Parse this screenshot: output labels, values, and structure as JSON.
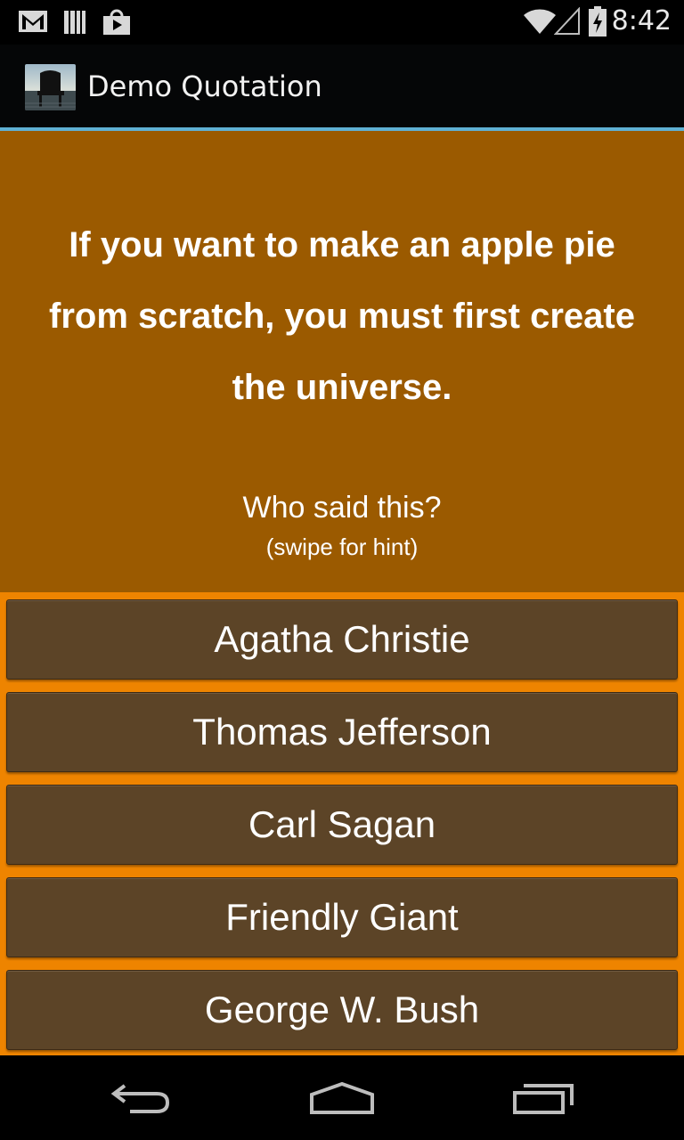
{
  "status_bar": {
    "time": "8:42",
    "icons": [
      "gmail-icon",
      "library-icon",
      "play-store-icon",
      "wifi-icon",
      "signal-icon",
      "battery-charging-icon"
    ]
  },
  "action_bar": {
    "app_icon": "chair-photo-icon",
    "title": "Demo Quotation",
    "accent_color": "#5fb0d4"
  },
  "quote": {
    "text": "If you want to make an apple pie from scratch, you must first create the universe.",
    "question": "Who said this?",
    "hint": "(swipe for hint)",
    "background_color": "#9b5a00"
  },
  "answers": {
    "options": [
      "Agatha Christie",
      "Thomas Jefferson",
      "Carl Sagan",
      "Friendly Giant",
      "George W. Bush"
    ],
    "button_color": "#5c4427",
    "background_color": "#ee8400"
  },
  "nav_bar": {
    "icons": [
      "back-icon",
      "home-icon",
      "recent-apps-icon"
    ]
  }
}
